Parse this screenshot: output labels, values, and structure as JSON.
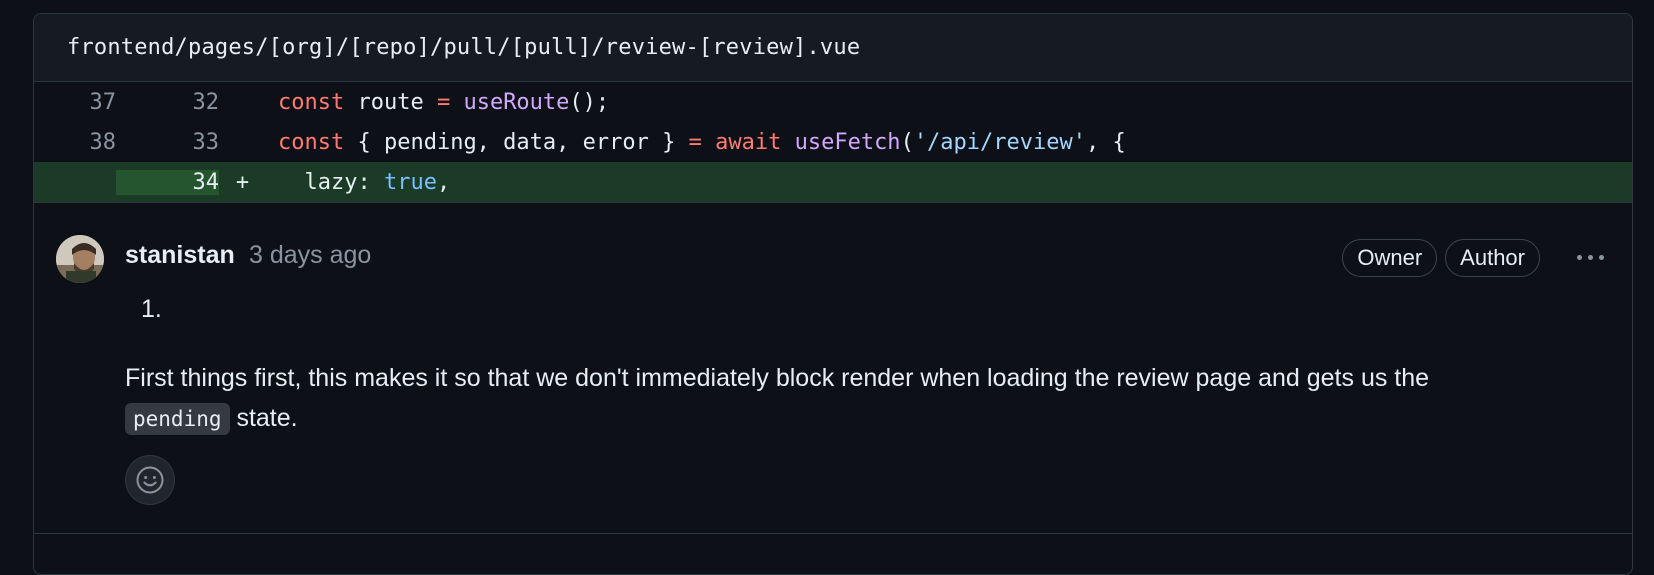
{
  "file": {
    "path": "frontend/pages/[org]/[repo]/pull/[pull]/review-[review].vue"
  },
  "diff": {
    "lines": [
      {
        "old": "37",
        "new": "32",
        "marker": ""
      },
      {
        "old": "38",
        "new": "33",
        "marker": ""
      },
      {
        "old": "",
        "new": "34",
        "marker": "+"
      }
    ],
    "tokens": {
      "l1_kw": "const",
      "l1_a": " route ",
      "l1_eq": "=",
      "l1_sp": " ",
      "l1_fn": "useRoute",
      "l1_end": "();",
      "l2_kw": "const",
      "l2_a": " { pending, data, error } ",
      "l2_eq": "=",
      "l2_sp": " ",
      "l2_await": "await",
      "l2_sp2": " ",
      "l2_fn": "useFetch",
      "l2_open": "(",
      "l2_str": "'/api/review'",
      "l2_end": ", {",
      "l3_a": "  lazy: ",
      "l3_bool": "true",
      "l3_end": ","
    }
  },
  "comment": {
    "username": "stanistan",
    "timestamp": "3 days ago",
    "badges": [
      "Owner",
      "Author"
    ],
    "list_number": "1.",
    "text_before": "First things first, this makes it so that we don't immediately block render when loading the review page and gets us the ",
    "code": "pending",
    "text_after": " state."
  },
  "icons": {
    "more": "kebab-horizontal-icon",
    "emoji": "smiley-icon",
    "avatar": "user-avatar"
  }
}
